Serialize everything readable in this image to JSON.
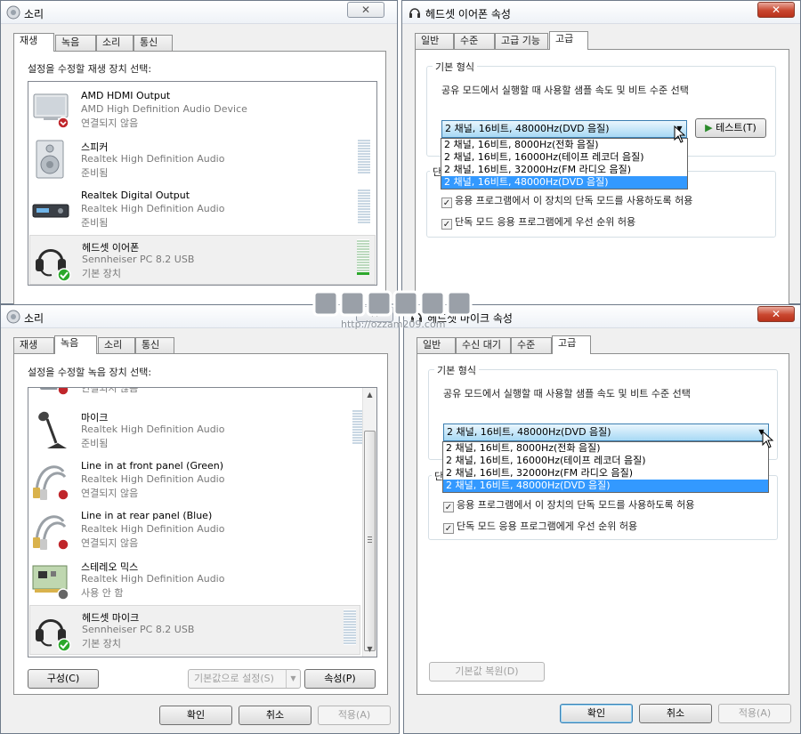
{
  "playback_window": {
    "title": "소리",
    "tabs": [
      "재생",
      "녹음",
      "소리",
      "통신"
    ],
    "instruction": "설정을 수정할 재생 장치 선택:",
    "devices": [
      {
        "name": "AMD HDMI Output",
        "desc": "AMD High Definition Audio Device",
        "status": "연결되지 않음"
      },
      {
        "name": "스피커",
        "desc": "Realtek High Definition Audio",
        "status": "준비됨"
      },
      {
        "name": "Realtek Digital Output",
        "desc": "Realtek High Definition Audio",
        "status": "준비됨"
      },
      {
        "name": "헤드셋 이어폰",
        "desc": "Sennheiser PC 8.2 USB",
        "status": "기본 장치"
      }
    ]
  },
  "recording_window": {
    "title": "소리",
    "tabs": [
      "재생",
      "녹음",
      "소리",
      "통신"
    ],
    "instruction": "설정을 수정할 녹음 장치 선택:",
    "partial_status": "연결되지 않음",
    "devices": [
      {
        "name": "마이크",
        "desc": "Realtek High Definition Audio",
        "status": "준비됨"
      },
      {
        "name": "Line in at front panel (Green)",
        "desc": "Realtek High Definition Audio",
        "status": "연결되지 않음"
      },
      {
        "name": "Line in at rear panel (Blue)",
        "desc": "Realtek High Definition Audio",
        "status": "연결되지 않음"
      },
      {
        "name": "스테레오 믹스",
        "desc": "Realtek High Definition Audio",
        "status": "사용 안 함"
      },
      {
        "name": "헤드셋 마이크",
        "desc": "Sennheiser PC 8.2 USB",
        "status": "기본 장치"
      }
    ],
    "buttons": {
      "configure": "구성(C)",
      "set_default": "기본값으로 설정(S)",
      "properties": "속성(P)",
      "ok": "확인",
      "cancel": "취소",
      "apply": "적용(A)"
    }
  },
  "headphone_props": {
    "title": "헤드셋 이어폰 속성",
    "tabs": [
      "일반",
      "수준",
      "고급 기능",
      "고급"
    ],
    "group_title": "기본 형식",
    "description": "공유 모드에서 실행할 때 사용할 샘플 속도 및 비트 수준 선택",
    "selected_format": "2 채널, 16비트, 48000Hz(DVD 음질)",
    "options": [
      "2 채널, 16비트, 8000Hz(전화 음질)",
      "2 채널, 16비트, 16000Hz(테이프 레코더 음질)",
      "2 채널, 16비트, 32000Hz(FM 라디오 음질)",
      "2 채널, 16비트, 48000Hz(DVD 음질)"
    ],
    "test_button": "테스트(T)",
    "exclusive_group_fragment": "단",
    "check1": "응용 프로그램에서 이 장치의 단독 모드를 사용하도록 허용",
    "check2": "단독 모드 응용 프로그램에게 우선 순위 허용"
  },
  "mic_props": {
    "title": "헤드셋 마이크 속성",
    "tabs": [
      "일반",
      "수신 대기",
      "수준",
      "고급"
    ],
    "group_title": "기본 형식",
    "description": "공유 모드에서 실행할 때 사용할 샘플 속도 및 비트 수준 선택",
    "selected_format": "2 채널, 16비트, 48000Hz(DVD 음질)",
    "options": [
      "2 채널, 16비트, 8000Hz(전화 음질)",
      "2 채널, 16비트, 16000Hz(테이프 레코더 음질)",
      "2 채널, 16비트, 32000Hz(FM 라디오 음질)",
      "2 채널, 16비트, 48000Hz(DVD 음질)"
    ],
    "exclusive_group_fragment": "단",
    "check1": "응용 프로그램에서 이 장치의 단독 모드를 사용하도록 허용",
    "check2": "단독 모드 응용 프로그램에게 우선 순위 허용",
    "restore_default": "기본값 복원(D)",
    "ok": "확인",
    "cancel": "취소",
    "apply": "적용(A)"
  },
  "watermark": {
    "url": "http://ozzam209.com"
  },
  "colors": {
    "highlight": "#3399ff",
    "close_red": "#c9472f",
    "status_green": "#2ca82c",
    "status_red": "#c0262b"
  }
}
